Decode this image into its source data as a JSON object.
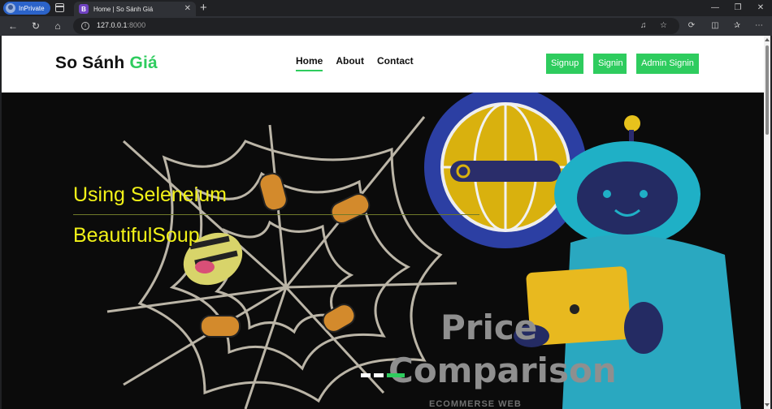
{
  "browser": {
    "profile_label": "InPrivate",
    "tab": {
      "title": "Home | So Sánh Giá",
      "favicon_letter": "B"
    },
    "url_host": "127.0.0.1",
    "url_port": ":8000"
  },
  "site": {
    "logo": {
      "part1": "So Sánh ",
      "part2": "Giá"
    },
    "nav": [
      {
        "label": "Home",
        "active": true
      },
      {
        "label": "About",
        "active": false
      },
      {
        "label": "Contact",
        "active": false
      }
    ],
    "buttons": {
      "signup": "Signup",
      "signin": "Signin",
      "admin_signin": "Admin Signin"
    },
    "accent_color": "#2ecc5e",
    "hero": {
      "line1": "Using Seleneium",
      "line2": "BeautifulSoup",
      "text_color": "#f2f218",
      "image_text": {
        "title1": "Price",
        "title2": "Comparison",
        "subtitle": "ECOMMERSE WEB"
      },
      "indicators": {
        "count": 3,
        "active_index": 2
      }
    }
  }
}
